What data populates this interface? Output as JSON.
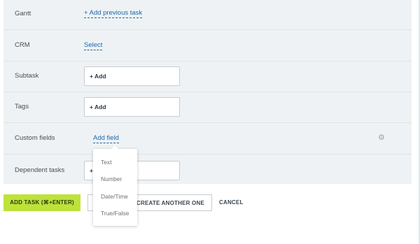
{
  "fields": {
    "gantt": {
      "label": "Gantt",
      "action": "+ Add previous task"
    },
    "crm": {
      "label": "CRM",
      "action": "Select"
    },
    "subtask": {
      "label": "Subtask",
      "action": "+ Add"
    },
    "tags": {
      "label": "Tags",
      "action": "+ Add"
    },
    "custom_fields": {
      "label": "Custom fields",
      "action": "Add field"
    },
    "dependent_tasks": {
      "label": "Dependent tasks",
      "action": "+"
    }
  },
  "dropdown": {
    "items": [
      "Text",
      "Number",
      "Date/Time",
      "True/False"
    ]
  },
  "footer": {
    "add_task": "ADD TASK (⌘+ENTER)",
    "create_another": "D CREATE ANOTHER ONE",
    "cancel": "CANCEL"
  },
  "colors": {
    "panel_bg": "#eef2f4",
    "link": "#2067b0",
    "primary_button": "#bde33a"
  },
  "icons": {
    "custom_fields_settings": "gear-icon"
  }
}
